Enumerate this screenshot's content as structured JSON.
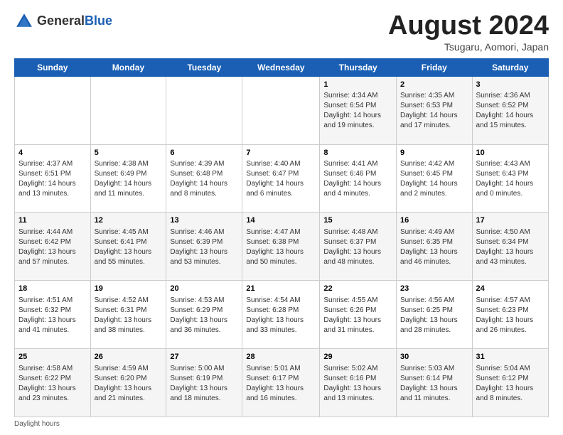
{
  "header": {
    "logo_general": "General",
    "logo_blue": "Blue",
    "month_title": "August 2024",
    "subtitle": "Tsugaru, Aomori, Japan"
  },
  "calendar": {
    "days_of_week": [
      "Sunday",
      "Monday",
      "Tuesday",
      "Wednesday",
      "Thursday",
      "Friday",
      "Saturday"
    ],
    "weeks": [
      [
        {
          "day": "",
          "info": ""
        },
        {
          "day": "",
          "info": ""
        },
        {
          "day": "",
          "info": ""
        },
        {
          "day": "",
          "info": ""
        },
        {
          "day": "1",
          "info": "Sunrise: 4:34 AM\nSunset: 6:54 PM\nDaylight: 14 hours\nand 19 minutes."
        },
        {
          "day": "2",
          "info": "Sunrise: 4:35 AM\nSunset: 6:53 PM\nDaylight: 14 hours\nand 17 minutes."
        },
        {
          "day": "3",
          "info": "Sunrise: 4:36 AM\nSunset: 6:52 PM\nDaylight: 14 hours\nand 15 minutes."
        }
      ],
      [
        {
          "day": "4",
          "info": "Sunrise: 4:37 AM\nSunset: 6:51 PM\nDaylight: 14 hours\nand 13 minutes."
        },
        {
          "day": "5",
          "info": "Sunrise: 4:38 AM\nSunset: 6:49 PM\nDaylight: 14 hours\nand 11 minutes."
        },
        {
          "day": "6",
          "info": "Sunrise: 4:39 AM\nSunset: 6:48 PM\nDaylight: 14 hours\nand 8 minutes."
        },
        {
          "day": "7",
          "info": "Sunrise: 4:40 AM\nSunset: 6:47 PM\nDaylight: 14 hours\nand 6 minutes."
        },
        {
          "day": "8",
          "info": "Sunrise: 4:41 AM\nSunset: 6:46 PM\nDaylight: 14 hours\nand 4 minutes."
        },
        {
          "day": "9",
          "info": "Sunrise: 4:42 AM\nSunset: 6:45 PM\nDaylight: 14 hours\nand 2 minutes."
        },
        {
          "day": "10",
          "info": "Sunrise: 4:43 AM\nSunset: 6:43 PM\nDaylight: 14 hours\nand 0 minutes."
        }
      ],
      [
        {
          "day": "11",
          "info": "Sunrise: 4:44 AM\nSunset: 6:42 PM\nDaylight: 13 hours\nand 57 minutes."
        },
        {
          "day": "12",
          "info": "Sunrise: 4:45 AM\nSunset: 6:41 PM\nDaylight: 13 hours\nand 55 minutes."
        },
        {
          "day": "13",
          "info": "Sunrise: 4:46 AM\nSunset: 6:39 PM\nDaylight: 13 hours\nand 53 minutes."
        },
        {
          "day": "14",
          "info": "Sunrise: 4:47 AM\nSunset: 6:38 PM\nDaylight: 13 hours\nand 50 minutes."
        },
        {
          "day": "15",
          "info": "Sunrise: 4:48 AM\nSunset: 6:37 PM\nDaylight: 13 hours\nand 48 minutes."
        },
        {
          "day": "16",
          "info": "Sunrise: 4:49 AM\nSunset: 6:35 PM\nDaylight: 13 hours\nand 46 minutes."
        },
        {
          "day": "17",
          "info": "Sunrise: 4:50 AM\nSunset: 6:34 PM\nDaylight: 13 hours\nand 43 minutes."
        }
      ],
      [
        {
          "day": "18",
          "info": "Sunrise: 4:51 AM\nSunset: 6:32 PM\nDaylight: 13 hours\nand 41 minutes."
        },
        {
          "day": "19",
          "info": "Sunrise: 4:52 AM\nSunset: 6:31 PM\nDaylight: 13 hours\nand 38 minutes."
        },
        {
          "day": "20",
          "info": "Sunrise: 4:53 AM\nSunset: 6:29 PM\nDaylight: 13 hours\nand 36 minutes."
        },
        {
          "day": "21",
          "info": "Sunrise: 4:54 AM\nSunset: 6:28 PM\nDaylight: 13 hours\nand 33 minutes."
        },
        {
          "day": "22",
          "info": "Sunrise: 4:55 AM\nSunset: 6:26 PM\nDaylight: 13 hours\nand 31 minutes."
        },
        {
          "day": "23",
          "info": "Sunrise: 4:56 AM\nSunset: 6:25 PM\nDaylight: 13 hours\nand 28 minutes."
        },
        {
          "day": "24",
          "info": "Sunrise: 4:57 AM\nSunset: 6:23 PM\nDaylight: 13 hours\nand 26 minutes."
        }
      ],
      [
        {
          "day": "25",
          "info": "Sunrise: 4:58 AM\nSunset: 6:22 PM\nDaylight: 13 hours\nand 23 minutes."
        },
        {
          "day": "26",
          "info": "Sunrise: 4:59 AM\nSunset: 6:20 PM\nDaylight: 13 hours\nand 21 minutes."
        },
        {
          "day": "27",
          "info": "Sunrise: 5:00 AM\nSunset: 6:19 PM\nDaylight: 13 hours\nand 18 minutes."
        },
        {
          "day": "28",
          "info": "Sunrise: 5:01 AM\nSunset: 6:17 PM\nDaylight: 13 hours\nand 16 minutes."
        },
        {
          "day": "29",
          "info": "Sunrise: 5:02 AM\nSunset: 6:16 PM\nDaylight: 13 hours\nand 13 minutes."
        },
        {
          "day": "30",
          "info": "Sunrise: 5:03 AM\nSunset: 6:14 PM\nDaylight: 13 hours\nand 11 minutes."
        },
        {
          "day": "31",
          "info": "Sunrise: 5:04 AM\nSunset: 6:12 PM\nDaylight: 13 hours\nand 8 minutes."
        }
      ]
    ]
  },
  "footer": {
    "daylight_label": "Daylight hours"
  }
}
